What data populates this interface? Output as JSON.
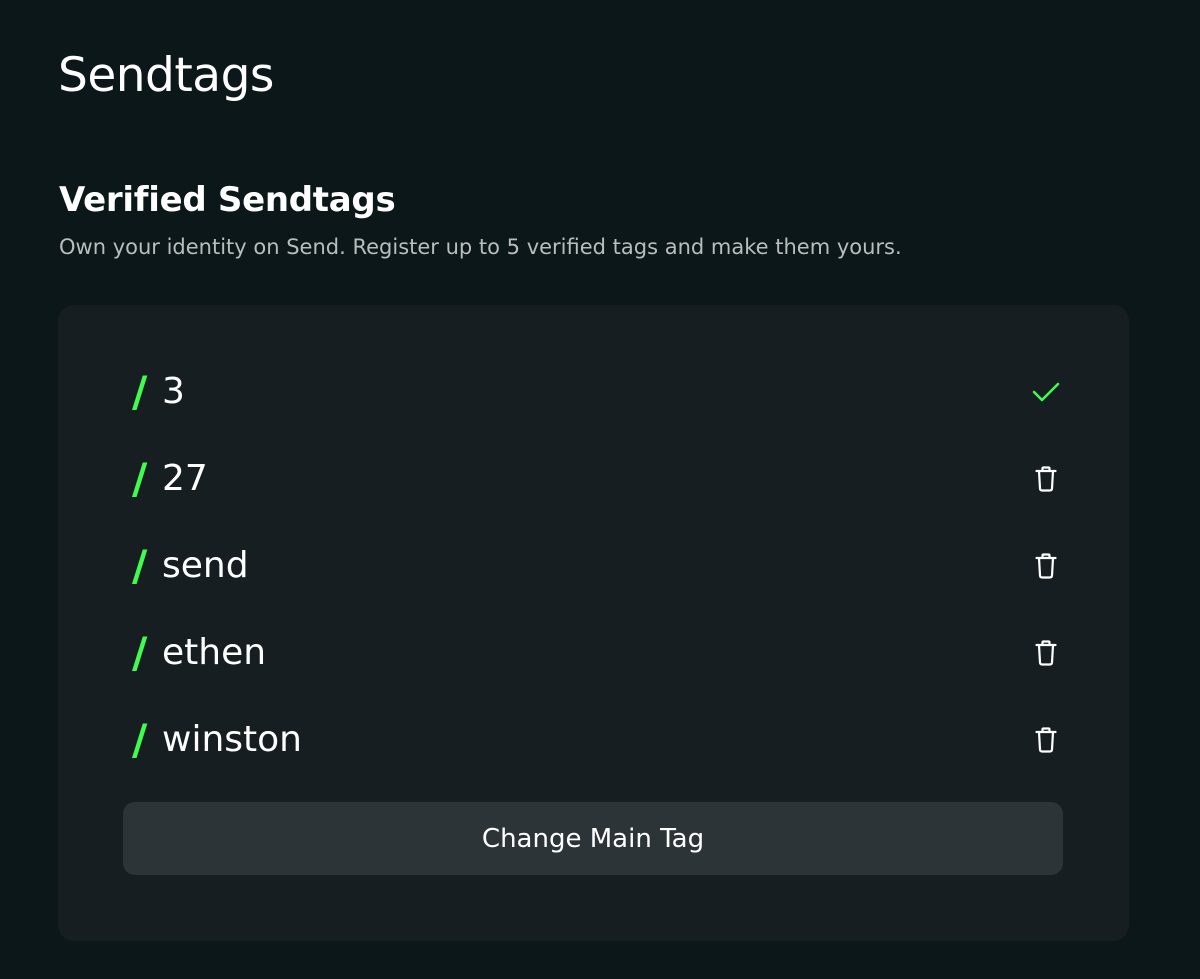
{
  "page": {
    "title": "Sendtags"
  },
  "section": {
    "title": "Verified Sendtags",
    "subtitle": "Own your identity on Send. Register up to 5 verified tags and make them yours."
  },
  "tags": [
    {
      "slash": "/",
      "name": "3",
      "action": "check-icon",
      "is_main": true
    },
    {
      "slash": "/",
      "name": "27",
      "action": "trash-icon",
      "is_main": false
    },
    {
      "slash": "/",
      "name": "send",
      "action": "trash-icon",
      "is_main": false
    },
    {
      "slash": "/",
      "name": "ethen",
      "action": "trash-icon",
      "is_main": false
    },
    {
      "slash": "/",
      "name": "winston",
      "action": "trash-icon",
      "is_main": false
    }
  ],
  "actions": {
    "change_main_tag_label": "Change Main Tag"
  },
  "colors": {
    "background": "#0c1719",
    "card": "#161e21",
    "accent": "#40fb50",
    "button": "#2d3437",
    "muted_text": "#b8bdbe"
  }
}
